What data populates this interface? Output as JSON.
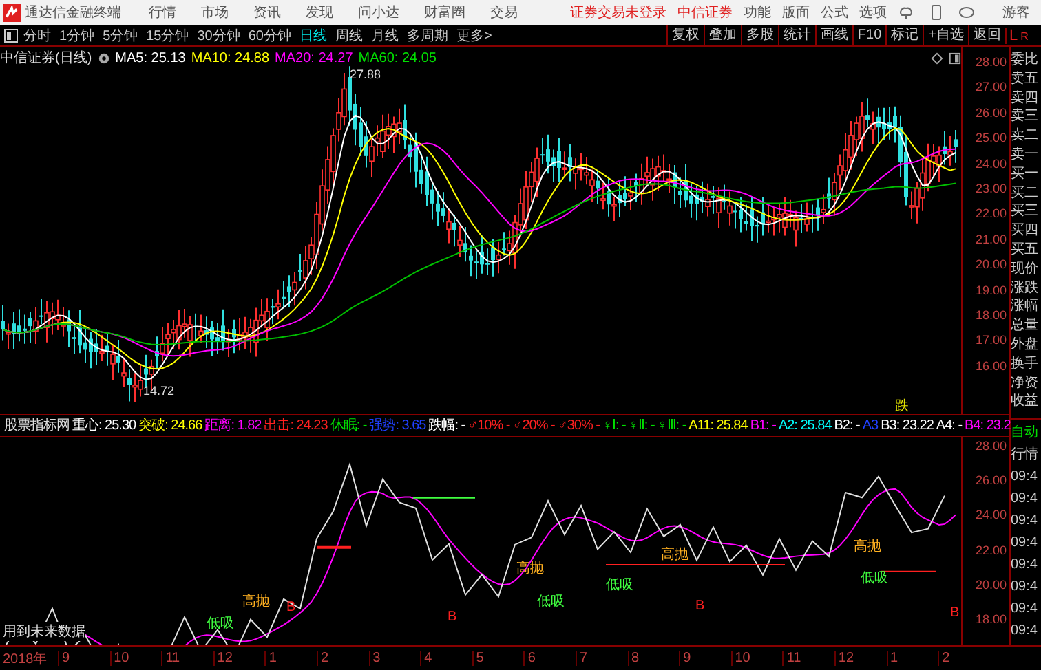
{
  "app": {
    "title": "通达信金融终端",
    "menu": [
      "行情",
      "市场",
      "资讯",
      "发现",
      "问小达",
      "财富圈",
      "交易"
    ],
    "login_status": "证券交易未登录",
    "broker": "中信证券",
    "tools": [
      "功能",
      "版面",
      "公式",
      "选项"
    ],
    "user": "游客"
  },
  "toolbar": {
    "periods": [
      {
        "label": "分时",
        "selected": false
      },
      {
        "label": "1分钟",
        "selected": false
      },
      {
        "label": "5分钟",
        "selected": false
      },
      {
        "label": "15分钟",
        "selected": false
      },
      {
        "label": "30分钟",
        "selected": false
      },
      {
        "label": "60分钟",
        "selected": false
      },
      {
        "label": "日线",
        "selected": true
      },
      {
        "label": "周线",
        "selected": false
      },
      {
        "label": "月线",
        "selected": false
      },
      {
        "label": "多周期",
        "selected": false
      },
      {
        "label": "更多>",
        "selected": false
      }
    ],
    "actions": [
      "复权",
      "叠加",
      "多股",
      "统计",
      "画线",
      "F10",
      "标记",
      "+自选",
      "返回"
    ],
    "corner": [
      "L",
      "R"
    ]
  },
  "price_chart": {
    "title": "中信证券(日线)",
    "indicators": [
      {
        "text": "MA5: 25.13",
        "color": "#ffffff"
      },
      {
        "text": "MA10: 24.88",
        "color": "#ffff00"
      },
      {
        "text": "MA20: 24.27",
        "color": "#ff00ff"
      },
      {
        "text": "MA60: 24.05",
        "color": "#00e000"
      }
    ],
    "high_label": "27.88",
    "low_label": "14.72",
    "signal": "跌",
    "axis": [
      "28.00",
      "27.00",
      "26.00",
      "25.00",
      "24.00",
      "23.00",
      "22.00",
      "21.00",
      "20.00",
      "19.00",
      "18.00",
      "17.00",
      "16.00"
    ]
  },
  "indicator_panel": {
    "title": "股票指标网",
    "readings": [
      {
        "text": "重心: 25.30",
        "color": "#ffffff"
      },
      {
        "text": "突破: 24.66",
        "color": "#ffff00"
      },
      {
        "text": "距离: 1.82",
        "color": "#ff00ff"
      },
      {
        "text": "出击: 24.23",
        "color": "#ff2020"
      },
      {
        "text": "休眠: -",
        "color": "#00e000"
      },
      {
        "text": "强势: 3.65",
        "color": "#2040ff"
      },
      {
        "text": "跌幅: -",
        "color": "#ffffff"
      },
      {
        "text": "♂10% -",
        "color": "#ff2020"
      },
      {
        "text": "♂20% -",
        "color": "#ff2020"
      },
      {
        "text": "♂30% -",
        "color": "#ff2020"
      },
      {
        "text": "♀Ⅰ: -",
        "color": "#00e000"
      },
      {
        "text": "♀Ⅱ: -",
        "color": "#00e000"
      },
      {
        "text": "♀Ⅲ: -",
        "color": "#00e000"
      },
      {
        "text": "A11: 25.84",
        "color": "#ffff00"
      },
      {
        "text": "B1: -",
        "color": "#ff00ff"
      },
      {
        "text": "A2: 25.84",
        "color": "#00ffff"
      },
      {
        "text": "B2: -",
        "color": "#ffffff"
      },
      {
        "text": "A3",
        "color": "#2040ff"
      },
      {
        "text": "B3: 23.22",
        "color": "#ffffff"
      },
      {
        "text": "A4: -",
        "color": "#ffffff"
      },
      {
        "text": "B4: 23.2",
        "color": "#ff00ff"
      }
    ],
    "annotations": [
      {
        "text": "高抛",
        "kind": "sell"
      },
      {
        "text": "低吸",
        "kind": "buy"
      },
      {
        "text": "B",
        "kind": "mark"
      },
      {
        "text": "高抛",
        "kind": "sell"
      },
      {
        "text": "低吸",
        "kind": "buy"
      },
      {
        "text": "B",
        "kind": "mark"
      },
      {
        "text": "高抛",
        "kind": "sell"
      },
      {
        "text": "低吸",
        "kind": "buy"
      },
      {
        "text": "B",
        "kind": "mark"
      },
      {
        "text": "高抛",
        "kind": "sell"
      },
      {
        "text": "低吸",
        "kind": "buy"
      },
      {
        "text": "B",
        "kind": "mark"
      }
    ],
    "note": "用到未来数据",
    "axis": [
      "28.00",
      "26.00",
      "24.00",
      "22.00",
      "20.00",
      "18.00"
    ]
  },
  "quote_panel": {
    "labels": [
      "委比",
      "卖五",
      "卖四",
      "卖三",
      "卖二",
      "卖一",
      "买一",
      "买二",
      "买三",
      "买四",
      "买五",
      "现价",
      "涨跌",
      "涨幅",
      "总量",
      "外盘",
      "换手",
      "净资",
      "收益"
    ],
    "tabs": [
      "自动",
      "行情"
    ],
    "times": [
      "09:4",
      "09:4",
      "09:4",
      "09:4",
      "09:4",
      "09:4",
      "09:4",
      "09:4"
    ]
  },
  "time_axis": [
    "2018年",
    "9",
    "10",
    "11",
    "12",
    "1",
    "2",
    "3",
    "4",
    "5",
    "6",
    "7",
    "8",
    "9",
    "10",
    "11",
    "12",
    "1",
    "2"
  ]
}
